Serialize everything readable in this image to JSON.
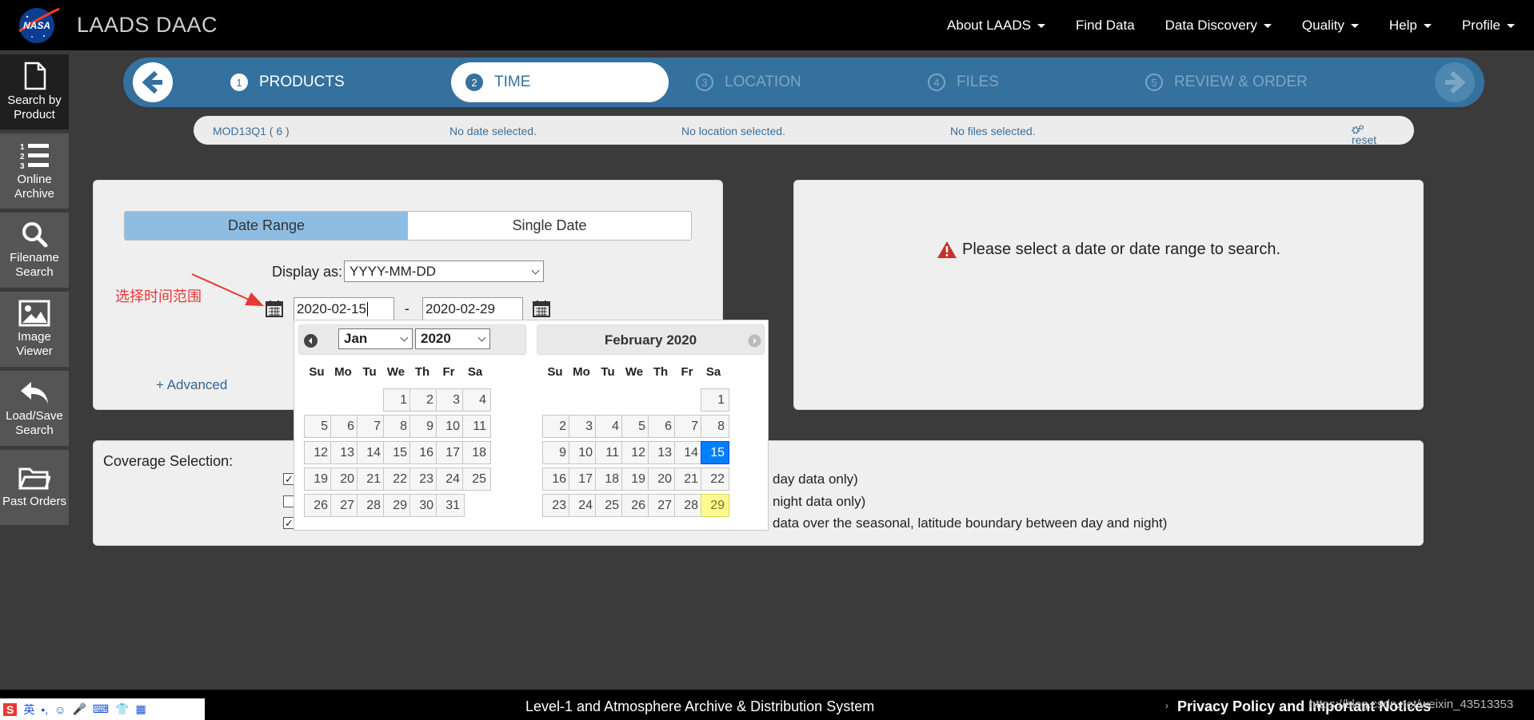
{
  "header": {
    "brand": "LAADS DAAC",
    "nav": [
      "About LAADS",
      "Find Data",
      "Data Discovery",
      "Quality",
      "Help",
      "Profile"
    ],
    "nav_has_caret": [
      true,
      false,
      true,
      true,
      true,
      true
    ]
  },
  "sidebar": {
    "items": [
      {
        "label": "Search by Product",
        "icon": "file-icon"
      },
      {
        "label": "Online Archive",
        "icon": "list-icon"
      },
      {
        "label": "Filename Search",
        "icon": "search-icon"
      },
      {
        "label": "Image Viewer",
        "icon": "image-icon"
      },
      {
        "label": "Load/Save Search",
        "icon": "reply-icon"
      },
      {
        "label": "Past Orders",
        "icon": "folder-icon"
      }
    ]
  },
  "steps": [
    {
      "num": "1",
      "label": "PRODUCTS"
    },
    {
      "num": "2",
      "label": "TIME"
    },
    {
      "num": "3",
      "label": "LOCATION"
    },
    {
      "num": "4",
      "label": "FILES"
    },
    {
      "num": "5",
      "label": "REVIEW & ORDER"
    }
  ],
  "summary": {
    "product": "MOD13Q1 ( 6 )",
    "date": "No date selected.",
    "location": "No location selected.",
    "files": "No files selected.",
    "reset": "reset"
  },
  "time_panel": {
    "tab_range": "Date Range",
    "tab_single": "Single Date",
    "display_as_label": "Display as:",
    "display_as_value": "YYYY-MM-DD",
    "start_date": "2020-02-15",
    "dash": "-",
    "end_date": "2020-02-29",
    "advanced": "+ Advanced",
    "annotation": "选择时间范围"
  },
  "message": "Please select a date or date range to search.",
  "calendar": {
    "month_select": "Jan",
    "year_select": "2020",
    "right_title": "February 2020",
    "dow": [
      "Su",
      "Mo",
      "Tu",
      "We",
      "Th",
      "Fr",
      "Sa"
    ],
    "jan_days": [
      "1",
      "2",
      "3",
      "4",
      "5",
      "6",
      "7",
      "8",
      "9",
      "10",
      "11",
      "12",
      "13",
      "14",
      "15",
      "16",
      "17",
      "18",
      "19",
      "20",
      "21",
      "22",
      "23",
      "24",
      "25",
      "26",
      "27",
      "28",
      "29",
      "30",
      "31"
    ],
    "feb_days": [
      "1",
      "2",
      "3",
      "4",
      "5",
      "6",
      "7",
      "8",
      "9",
      "10",
      "11",
      "12",
      "13",
      "14",
      "15",
      "16",
      "17",
      "18",
      "19",
      "20",
      "21",
      "22",
      "23",
      "24",
      "25",
      "26",
      "27",
      "28",
      "29"
    ],
    "selected_day": "15",
    "today_day": "29"
  },
  "coverage": {
    "label": "Coverage Selection:",
    "options": [
      {
        "checked": true,
        "tail": "day data only)"
      },
      {
        "checked": false,
        "tail": "night data only)"
      },
      {
        "checked": true,
        "tail": "data over the seasonal, latitude boundary between day and night)"
      }
    ]
  },
  "footer": {
    "center": "Level-1 and Atmosphere Archive & Distribution System",
    "right": "Privacy Policy and Important Notices",
    "watermark": "https://blog.csdn.net/weixin_43513353"
  },
  "ime": {
    "items": [
      "S",
      "英",
      "•,",
      "☺",
      "🎤",
      "⌨",
      "👕",
      "▦"
    ]
  },
  "colors": {
    "accent": "#34719f",
    "tab_active": "#8ebde3",
    "selected_day": "#007fff",
    "today_day": "#fffa90",
    "warning": "#c9302c"
  }
}
